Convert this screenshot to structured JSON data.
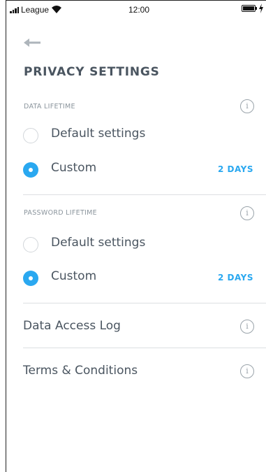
{
  "status_bar": {
    "carrier": "League",
    "time": "12:00"
  },
  "header": {
    "title": "PRIVACY SETTINGS"
  },
  "data_lifetime": {
    "label": "DATA LIFETIME",
    "options": [
      {
        "label": "Default settings",
        "selected": false
      },
      {
        "label": "Custom",
        "selected": true,
        "value": "2 DAYS"
      }
    ]
  },
  "password_lifetime": {
    "label": "PASSWORD LIFETIME",
    "options": [
      {
        "label": "Default settings",
        "selected": false
      },
      {
        "label": "Custom",
        "selected": true,
        "value": "2 DAYS"
      }
    ]
  },
  "links": [
    {
      "label": "Data Access Log"
    },
    {
      "label": "Terms & Conditions"
    }
  ],
  "info_glyph": "i",
  "colors": {
    "accent": "#2aa8f0",
    "text": "#4a5560",
    "muted": "#8a949c"
  }
}
